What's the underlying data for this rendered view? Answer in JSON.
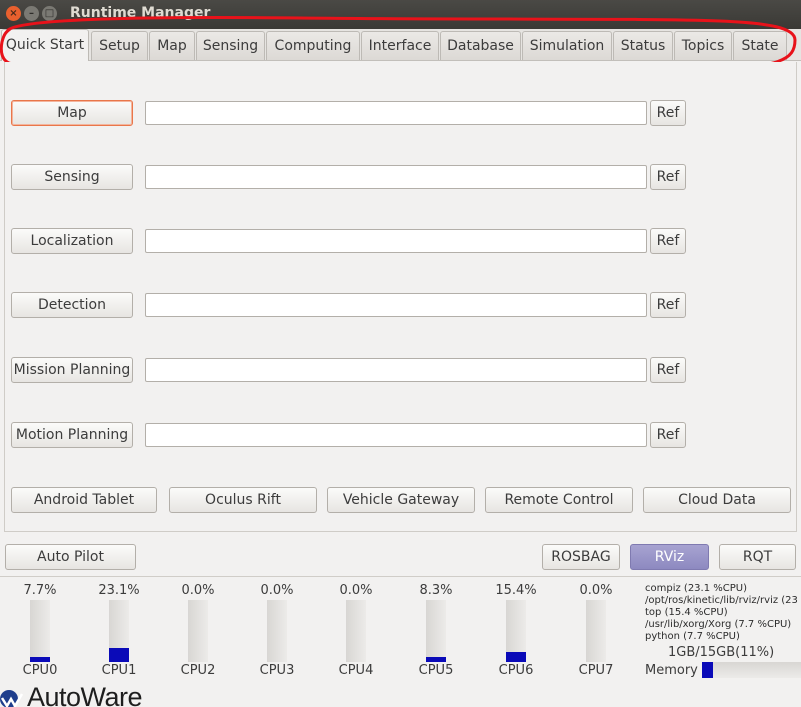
{
  "window": {
    "title": "Runtime Manager"
  },
  "tabs": [
    {
      "label": "Quick Start"
    },
    {
      "label": "Setup"
    },
    {
      "label": "Map"
    },
    {
      "label": "Sensing"
    },
    {
      "label": "Computing"
    },
    {
      "label": "Interface"
    },
    {
      "label": "Database"
    },
    {
      "label": "Simulation"
    },
    {
      "label": "Status"
    },
    {
      "label": "Topics"
    },
    {
      "label": "State"
    }
  ],
  "quickstart": {
    "rows": [
      {
        "label": "Map",
        "value": "",
        "ref": "Ref"
      },
      {
        "label": "Sensing",
        "value": "",
        "ref": "Ref"
      },
      {
        "label": "Localization",
        "value": "",
        "ref": "Ref"
      },
      {
        "label": "Detection",
        "value": "",
        "ref": "Ref"
      },
      {
        "label": "Mission Planning",
        "value": "",
        "ref": "Ref"
      },
      {
        "label": "Motion Planning",
        "value": "",
        "ref": "Ref"
      }
    ],
    "bottom_buttons": [
      {
        "label": "Android Tablet"
      },
      {
        "label": "Oculus Rift"
      },
      {
        "label": "Vehicle Gateway"
      },
      {
        "label": "Remote Control"
      },
      {
        "label": "Cloud Data"
      }
    ]
  },
  "actions": {
    "auto_pilot": "Auto Pilot",
    "rosbag": "ROSBAG",
    "rviz": "RViz",
    "rqt": "RQT"
  },
  "cpus": [
    {
      "name": "CPU0",
      "percent": "7.7%",
      "level": 7.7
    },
    {
      "name": "CPU1",
      "percent": "23.1%",
      "level": 23.1
    },
    {
      "name": "CPU2",
      "percent": "0.0%",
      "level": 0
    },
    {
      "name": "CPU3",
      "percent": "0.0%",
      "level": 0
    },
    {
      "name": "CPU4",
      "percent": "0.0%",
      "level": 0
    },
    {
      "name": "CPU5",
      "percent": "8.3%",
      "level": 8.3
    },
    {
      "name": "CPU6",
      "percent": "15.4%",
      "level": 15.4
    },
    {
      "name": "CPU7",
      "percent": "0.0%",
      "level": 0
    }
  ],
  "processes": [
    "compiz (23.1 %CPU)",
    "/opt/ros/kinetic/lib/rviz/rviz (23",
    "top (15.4 %CPU)",
    "/usr/lib/xorg/Xorg (7.7 %CPU)",
    "python (7.7 %CPU)"
  ],
  "memory": {
    "usage_text": "1GB/15GB(11%)",
    "label": "Memory",
    "level": 11
  },
  "logo": {
    "text": "AutoWare"
  },
  "colors": {
    "bar_fill": "#0a0ab8",
    "annotation": "#e8121a",
    "focus": "#e9764a"
  }
}
